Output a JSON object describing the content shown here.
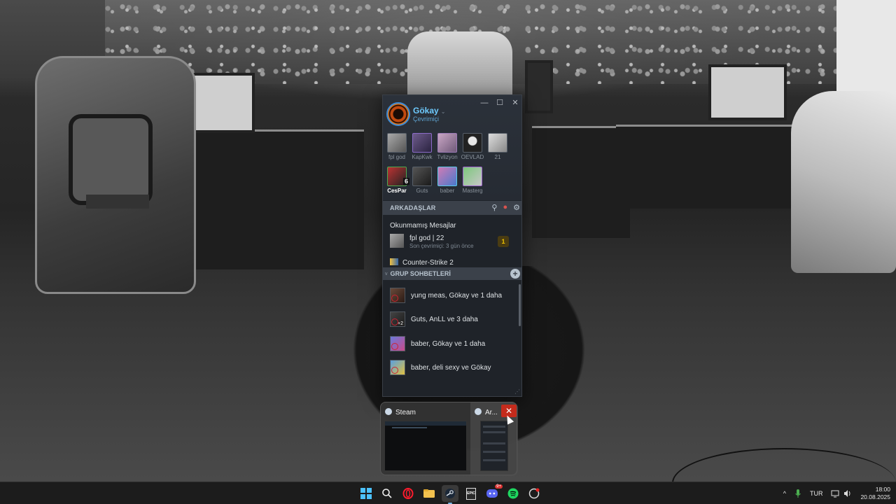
{
  "profile": {
    "name": "Gökay",
    "status": "Çevrimiçi"
  },
  "window_controls": {
    "minimize": "—",
    "maximize": "☐",
    "close": "✕"
  },
  "favorites": [
    {
      "label": "fpl god",
      "icon": "friend-avatar"
    },
    {
      "label": "KapKwk",
      "icon": "friend-avatar"
    },
    {
      "label": "Tvlizyon",
      "icon": "friend-avatar"
    },
    {
      "label": "OEVLAD",
      "icon": "friend-avatar"
    },
    {
      "label": "21",
      "icon": "friend-avatar"
    },
    {
      "label": "CesPar",
      "icon": "friend-avatar",
      "badge": "6"
    },
    {
      "label": "Guts",
      "icon": "friend-avatar"
    },
    {
      "label": "baber",
      "icon": "friend-avatar"
    },
    {
      "label": "Masterg",
      "icon": "friend-avatar"
    }
  ],
  "friends_section": {
    "title": "ARKADAŞLAR",
    "icons": [
      "search-icon",
      "add-friend-icon",
      "settings-icon"
    ]
  },
  "unread": {
    "title": "Okunmamış Mesajlar",
    "items": [
      {
        "name": "fpl god | 22",
        "sub": "Son çevrimiçi: 3 gün önce",
        "count": "1"
      }
    ]
  },
  "game_row": {
    "label": "Counter-Strike 2"
  },
  "group_section": {
    "title": "GRUP SOHBETLERİ",
    "caret": "v",
    "add": "+"
  },
  "groups": [
    {
      "name": "yung meas, Gökay ve 1 daha"
    },
    {
      "name": "Guts, AnLL ve 3 daha",
      "badge": "+2"
    },
    {
      "name": "baber, Gökay ve 1 daha"
    },
    {
      "name": "baber, deli sexy ve Gökay"
    }
  ],
  "preview": {
    "items": [
      {
        "title": "Steam"
      },
      {
        "title": "Ar..."
      }
    ],
    "close": "✕"
  },
  "taskbar": {
    "apps": [
      "start-icon",
      "search-icon",
      "opera-icon",
      "file-explorer-icon",
      "steam-icon",
      "epic-games-icon",
      "discord-icon",
      "spotify-icon",
      "app-icon"
    ],
    "discord_badge": "9+",
    "epic_label": "EPIC",
    "active_app": "steam-icon"
  },
  "tray": {
    "chevron": "^",
    "language": "TUR",
    "time": "18:00",
    "date": "20.08.2025"
  },
  "colors": {
    "accent": "#6ecbff",
    "online": "#5fa3d1",
    "unread_count": "#f0c400",
    "close_red": "#c42b1c"
  }
}
